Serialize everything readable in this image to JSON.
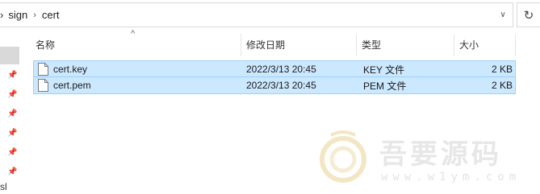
{
  "address_bar": {
    "lead_chevron": "›",
    "crumbs": [
      "sign",
      "cert"
    ],
    "separator": "›",
    "dropdown_glyph": "∨",
    "refresh_glyph": "↻"
  },
  "columns": [
    {
      "label": "名称"
    },
    {
      "label": "修改日期"
    },
    {
      "label": "类型"
    },
    {
      "label": "大小"
    }
  ],
  "sort_indicator": "^",
  "files": [
    {
      "name": "cert.key",
      "modified": "2022/3/13 20:45",
      "type": "KEY 文件",
      "size": "2 KB",
      "selected": true
    },
    {
      "name": "cert.pem",
      "modified": "2022/3/13 20:45",
      "type": "PEM 文件",
      "size": "2 KB",
      "selected": true
    }
  ],
  "nav_pane": {
    "pin_icon": "pin-icon",
    "cut_label": "sl"
  },
  "watermark": {
    "text": "吾要源码",
    "url": "www.w1ym.com"
  },
  "colors": {
    "selection_fill": "#cce8ff",
    "selection_border": "#99d1ff",
    "header_text": "#333333"
  }
}
